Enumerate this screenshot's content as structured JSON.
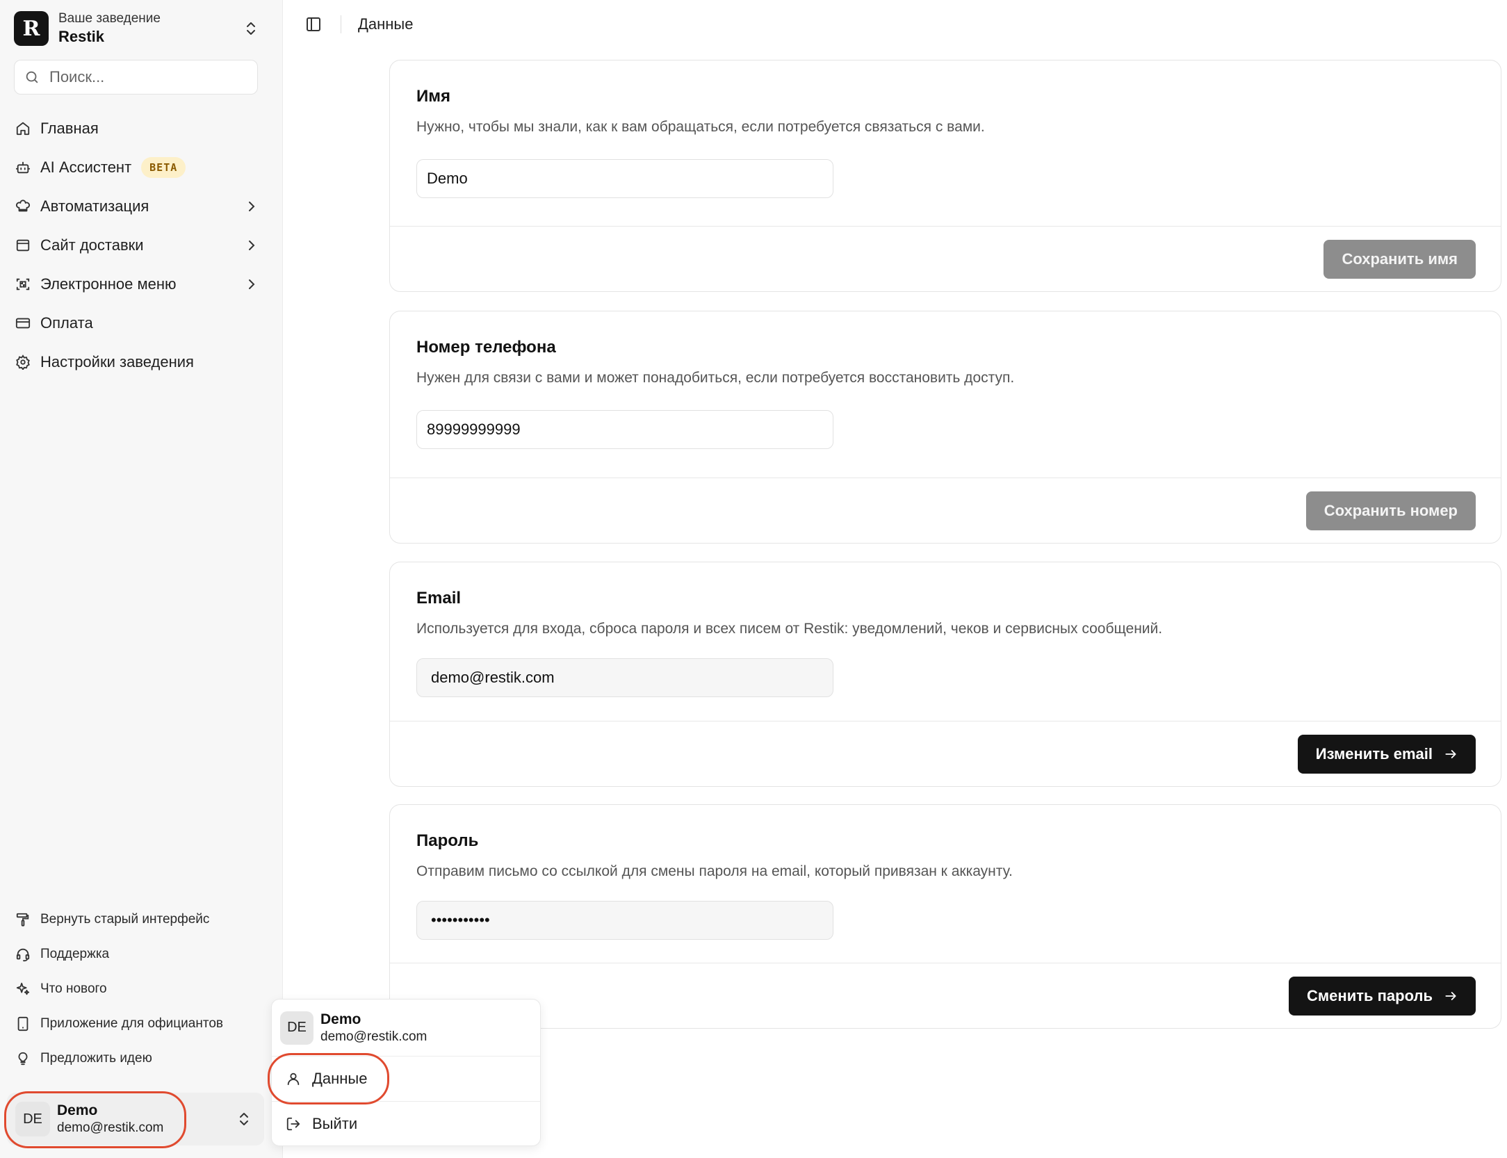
{
  "org": {
    "caption": "Ваше заведение",
    "name": "Restik",
    "logo_letter": "R"
  },
  "search": {
    "placeholder": "Поиск..."
  },
  "nav": {
    "items": [
      {
        "label": "Главная",
        "icon": "home-icon"
      },
      {
        "label": "AI Ассистент",
        "icon": "bot-icon",
        "badge": "BETA"
      },
      {
        "label": "Автоматизация",
        "icon": "chef-hat-icon",
        "chevron": true
      },
      {
        "label": "Сайт доставки",
        "icon": "browser-icon",
        "chevron": true
      },
      {
        "label": "Электронное меню",
        "icon": "qr-scan-icon",
        "chevron": true
      },
      {
        "label": "Оплата",
        "icon": "credit-card-icon"
      },
      {
        "label": "Настройки заведения",
        "icon": "gear-icon"
      }
    ]
  },
  "bottom_nav": {
    "items": [
      {
        "label": "Вернуть старый интерфейс",
        "icon": "paint-roller-icon"
      },
      {
        "label": "Поддержка",
        "icon": "headset-icon"
      },
      {
        "label": "Что нового",
        "icon": "sparkles-icon"
      },
      {
        "label": "Приложение для официантов",
        "icon": "tablet-icon"
      },
      {
        "label": "Предложить идею",
        "icon": "lightbulb-icon"
      }
    ]
  },
  "user": {
    "initials": "DE",
    "name": "Demo",
    "email": "demo@restik.com"
  },
  "topbar": {
    "breadcrumb": "Данные"
  },
  "cards": {
    "name": {
      "title": "Имя",
      "description": "Нужно, чтобы мы знали, как к вам обращаться, если потребуется связаться с вами.",
      "value": "Demo",
      "button": "Сохранить имя"
    },
    "phone": {
      "title": "Номер телефона",
      "description": "Нужен для связи с вами и может понадобиться, если потребуется восстановить доступ.",
      "value": "89999999999",
      "button": "Сохранить номер"
    },
    "email": {
      "title": "Email",
      "description": "Используется для входа, сброса пароля и всех писем от Restik: уведомлений, чеков и сервисных сообщений.",
      "value": "demo@restik.com",
      "button": "Изменить email"
    },
    "password": {
      "title": "Пароль",
      "description": "Отправим письмо со ссылкой для смены пароля на email, который привязан к аккаунту.",
      "value": "•••••••••••",
      "button": "Сменить пароль"
    }
  },
  "popup": {
    "items": [
      {
        "label": "Данные",
        "icon": "user-icon"
      },
      {
        "label": "Выйти",
        "icon": "logout-icon"
      }
    ]
  },
  "colors": {
    "highlight_ring": "#e04a2f",
    "dark_button": "#141414",
    "muted_button": "#8d8d8d",
    "beta_badge_bg": "#fdf0c9"
  }
}
